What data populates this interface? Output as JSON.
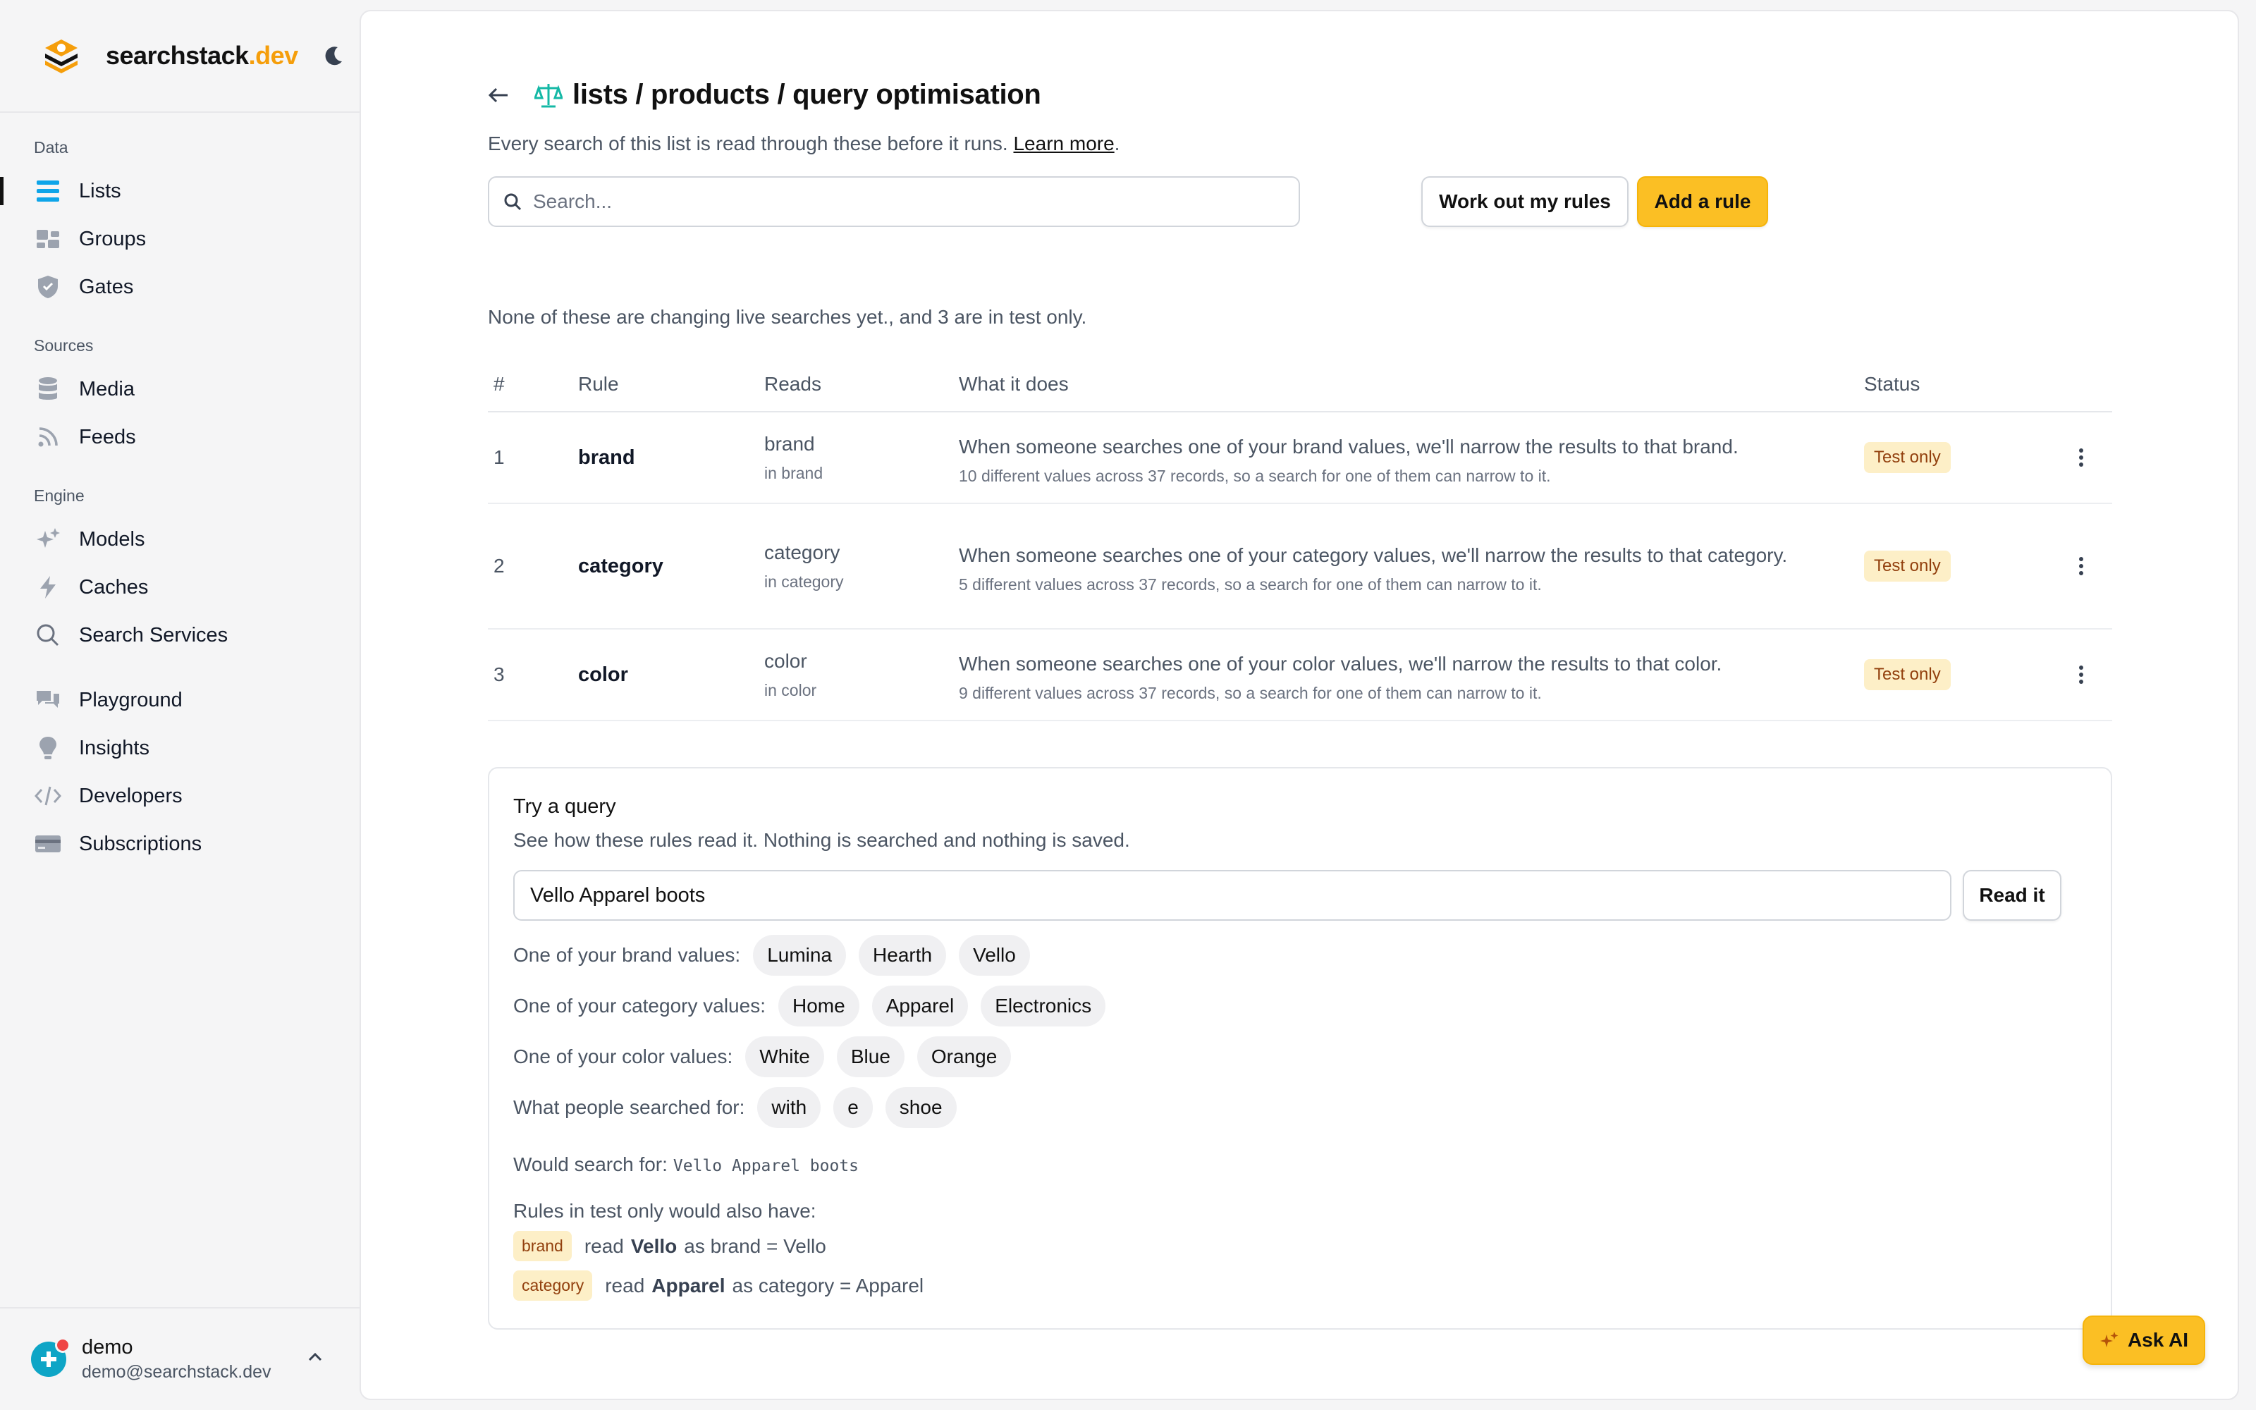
{
  "brand": {
    "name": "searchstack",
    "tld": ".dev"
  },
  "nav": {
    "sections": [
      {
        "heading": "Data",
        "items": [
          {
            "label": "Lists",
            "icon": "list-icon",
            "active": true
          },
          {
            "label": "Groups",
            "icon": "groups-icon"
          },
          {
            "label": "Gates",
            "icon": "shield-icon"
          }
        ]
      },
      {
        "heading": "Sources",
        "items": [
          {
            "label": "Media",
            "icon": "database-icon"
          },
          {
            "label": "Feeds",
            "icon": "rss-icon"
          }
        ]
      },
      {
        "heading": "Engine",
        "items": [
          {
            "label": "Models",
            "icon": "sparkles-icon"
          },
          {
            "label": "Caches",
            "icon": "bolt-icon"
          },
          {
            "label": "Search Services",
            "icon": "search-icon"
          }
        ]
      },
      {
        "heading": "",
        "items": [
          {
            "label": "Playground",
            "icon": "chat-icon"
          },
          {
            "label": "Insights",
            "icon": "lightbulb-icon"
          },
          {
            "label": "Developers",
            "icon": "code-icon"
          },
          {
            "label": "Subscriptions",
            "icon": "card-icon"
          }
        ]
      }
    ]
  },
  "user": {
    "name": "demo",
    "email": "demo@searchstack.dev"
  },
  "page": {
    "title": "lists / products / query optimisation",
    "subtitle": "Every search of this list is read through these before it runs.",
    "learn_more": "Learn more",
    "subtitle_end": ".",
    "search_placeholder": "Search...",
    "work_out_label": "Work out my rules",
    "add_rule_label": "Add a rule",
    "summary": "None of these are changing live searches yet., and 3 are in test only."
  },
  "table": {
    "headers": {
      "num": "#",
      "rule": "Rule",
      "reads": "Reads",
      "what": "What it does",
      "status": "Status"
    },
    "rows": [
      {
        "num": "1",
        "rule": "brand",
        "reads": "brand",
        "reads_sub": "in brand",
        "what": "When someone searches one of your brand values, we'll narrow the results to that brand.",
        "what_sub": "10 different values across 37 records, so a search for one of them can narrow to it.",
        "status": "Test only"
      },
      {
        "num": "2",
        "rule": "category",
        "reads": "category",
        "reads_sub": "in category",
        "what": "When someone searches one of your category values, we'll narrow the results to that category.",
        "what_sub": "5 different values across 37 records, so a search for one of them can narrow to it.",
        "status": "Test only"
      },
      {
        "num": "3",
        "rule": "color",
        "reads": "color",
        "reads_sub": "in color",
        "what": "When someone searches one of your color values, we'll narrow the results to that color.",
        "what_sub": "9 different values across 37 records, so a search for one of them can narrow to it.",
        "status": "Test only"
      }
    ]
  },
  "try": {
    "title": "Try a query",
    "desc": "See how these rules read it. Nothing is searched and nothing is saved.",
    "query": "Vello Apparel boots",
    "read_label": "Read it",
    "rows": [
      {
        "label": "One of your brand values:",
        "chips": [
          "Lumina",
          "Hearth",
          "Vello"
        ]
      },
      {
        "label": "One of your category values:",
        "chips": [
          "Home",
          "Apparel",
          "Electronics"
        ]
      },
      {
        "label": "One of your color values:",
        "chips": [
          "White",
          "Blue",
          "Orange"
        ]
      },
      {
        "label": "What people searched for:",
        "chips": [
          "with",
          "e",
          "shoe"
        ]
      }
    ],
    "would_label": "Would search for:",
    "would_value": "Vello Apparel boots",
    "also_label": "Rules in test only would also have:",
    "tags": [
      {
        "tag": "brand",
        "pre": "read",
        "term": "Vello",
        "post": "as brand = Vello"
      },
      {
        "tag": "category",
        "pre": "read",
        "term": "Apparel",
        "post": "as category = Apparel"
      }
    ]
  },
  "ask_ai_label": "Ask AI",
  "colors": {
    "accent": "#fbbf24",
    "badge_bg": "#fdefc7",
    "badge_text": "#92400e",
    "icon_blue": "#0ea5e9"
  }
}
